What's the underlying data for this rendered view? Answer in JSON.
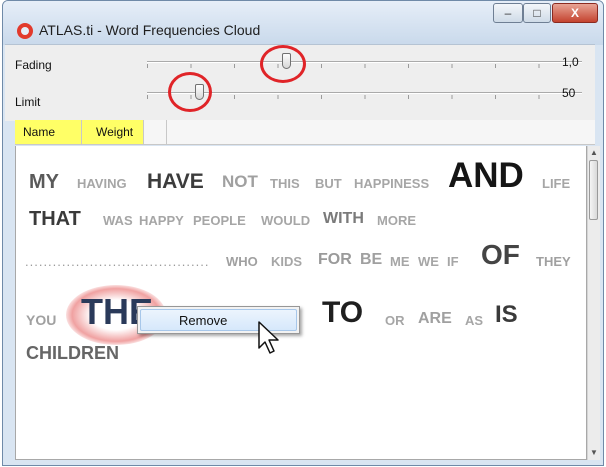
{
  "window": {
    "title": "ATLAS.ti - Word Frequencies Cloud",
    "buttons": {
      "minimize": "–",
      "maximize": "□",
      "close": "X"
    },
    "accent_color": "#e23a2c"
  },
  "controls": {
    "fading": {
      "label": "Fading",
      "value": "1,0",
      "slider_position": 0.32
    },
    "limit": {
      "label": "Limit",
      "value": "50",
      "slider_position": 0.12
    },
    "annotation_color": "#e02428"
  },
  "columns": {
    "name": "Name",
    "weight": "Weight",
    "highlight_color": "#ffff66"
  },
  "cloud": {
    "words": [
      {
        "text": "MY",
        "color": "#5a5a5a"
      },
      {
        "text": "HAVING",
        "color": "#a6a6a6"
      },
      {
        "text": "HAVE",
        "color": "#3c3c3c"
      },
      {
        "text": "NOT",
        "color": "#a0a0a0"
      },
      {
        "text": "THIS",
        "color": "#a6a6a6"
      },
      {
        "text": "BUT",
        "color": "#a6a6a6"
      },
      {
        "text": "HAPPINESS",
        "color": "#a6a6a6"
      },
      {
        "text": "AND",
        "color": "#151515"
      },
      {
        "text": "LIFE",
        "color": "#a6a6a6"
      },
      {
        "text": "THAT",
        "color": "#3a3a3a"
      },
      {
        "text": "WAS",
        "color": "#a6a6a6"
      },
      {
        "text": "HAPPY",
        "color": "#a6a6a6"
      },
      {
        "text": "PEOPLE",
        "color": "#a6a6a6"
      },
      {
        "text": "WOULD",
        "color": "#a6a6a6"
      },
      {
        "text": "WITH",
        "color": "#7a7a7a"
      },
      {
        "text": "MORE",
        "color": "#a6a6a6"
      },
      {
        "text": "WHO",
        "color": "#a0a0a0"
      },
      {
        "text": "KIDS",
        "color": "#a6a6a6"
      },
      {
        "text": "FOR",
        "color": "#9a9a9a"
      },
      {
        "text": "BE",
        "color": "#a0a0a0"
      },
      {
        "text": "ME",
        "color": "#a6a6a6"
      },
      {
        "text": "WE",
        "color": "#a6a6a6"
      },
      {
        "text": "IF",
        "color": "#a6a6a6"
      },
      {
        "text": "OF",
        "color": "#444444"
      },
      {
        "text": "THEY",
        "color": "#a0a0a0"
      },
      {
        "text": "YOU",
        "color": "#a0a0a0"
      },
      {
        "text": "THE",
        "color": "#2a3a5a"
      },
      {
        "text": "TO",
        "color": "#1f1f1f"
      },
      {
        "text": "OR",
        "color": "#a6a6a6"
      },
      {
        "text": "ARE",
        "color": "#a0a0a0"
      },
      {
        "text": "AS",
        "color": "#a6a6a6"
      },
      {
        "text": "IS",
        "color": "#3a3a3a"
      },
      {
        "text": "CHILDREN",
        "color": "#666666"
      }
    ],
    "dots": "........................................"
  },
  "context_menu": {
    "items": [
      "Remove"
    ]
  }
}
